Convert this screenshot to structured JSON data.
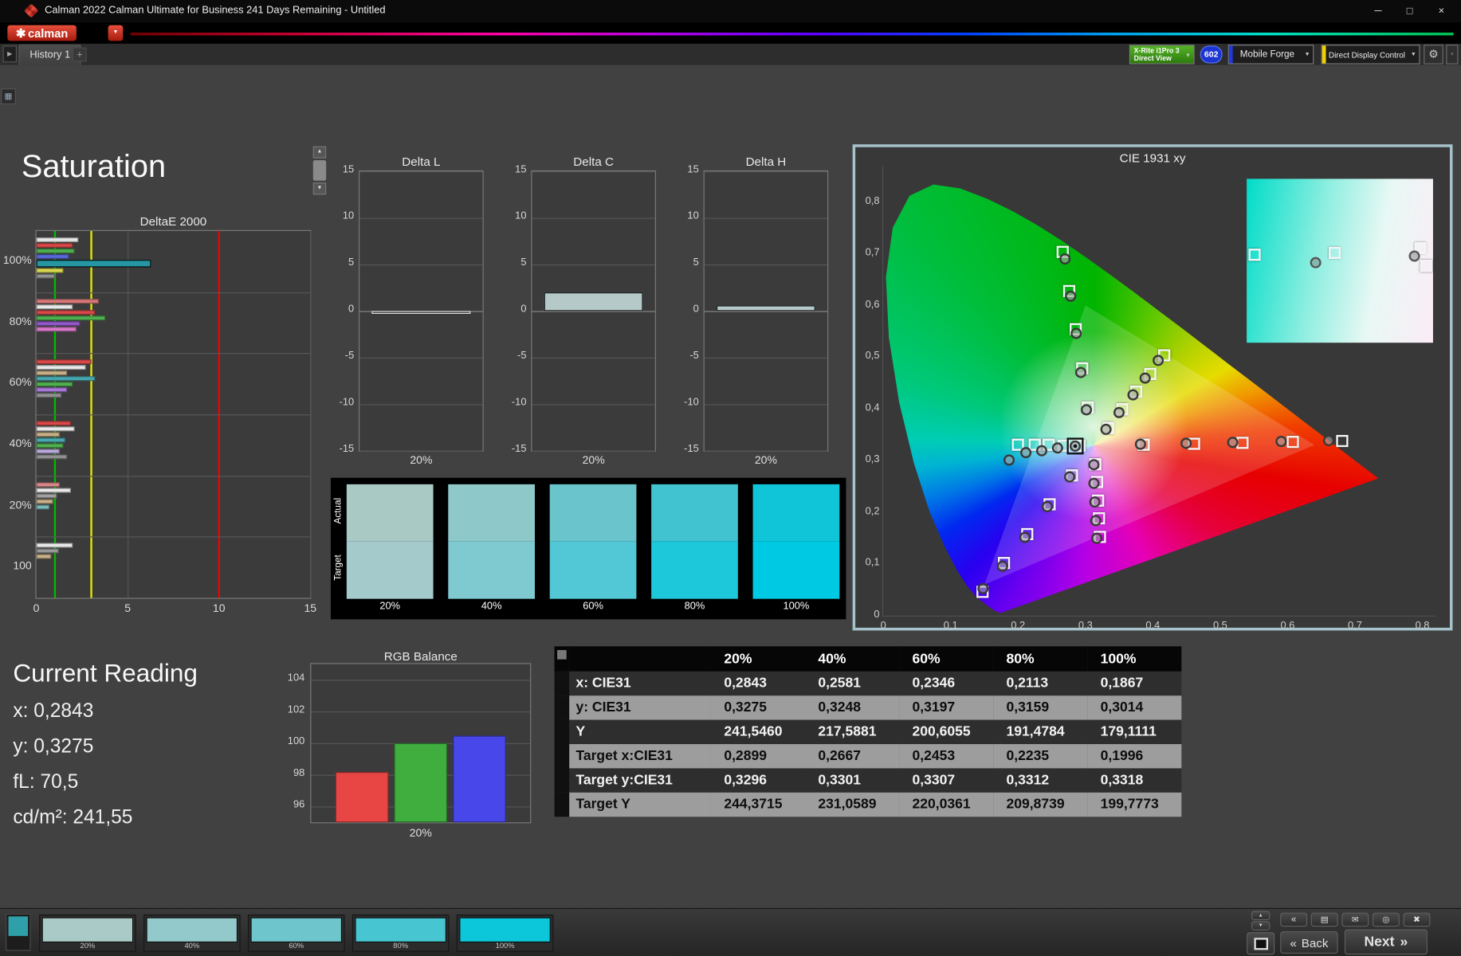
{
  "window": {
    "title": "Calman 2022 Calman Ultimate for Business 241 Days Remaining  - Untitled"
  },
  "brand": {
    "logo": "calman"
  },
  "tab_bar": {
    "tabs": [
      "History 1"
    ],
    "add": "+"
  },
  "toolbar": {
    "meter": {
      "line1": "X-Rite i1Pro 3",
      "line2": "Direct View"
    },
    "badge": "602",
    "source": "Mobile Forge",
    "source_accent": "#2038e0",
    "display_control": "Direct Display Control",
    "display_accent": "#f0d000"
  },
  "page": {
    "heading": "Saturation"
  },
  "current_reading": {
    "title": "Current Reading",
    "lines": [
      "x: 0,2843",
      "y: 0,3275",
      "fL: 70,5",
      "cd/m²: 241,55"
    ]
  },
  "footer": {
    "thumbnails": [
      {
        "label": "20%",
        "color": "#a9cac6"
      },
      {
        "label": "40%",
        "color": "#93c9ca"
      },
      {
        "label": "60%",
        "color": "#6ec6cc"
      },
      {
        "label": "80%",
        "color": "#47c5d0"
      },
      {
        "label": "100%",
        "color": "#0cc7da"
      }
    ],
    "back": "Back",
    "next": "Next"
  },
  "chart_data": [
    {
      "name": "deltaE2000",
      "type": "bar",
      "title": "DeltaE 2000",
      "orientation": "horizontal",
      "xlim": [
        0,
        15
      ],
      "xticks": [
        0,
        5,
        10,
        15
      ],
      "reference_lines": [
        {
          "value": 1,
          "color": "#00bb00"
        },
        {
          "value": 3,
          "color": "#e8e800"
        },
        {
          "value": 10,
          "color": "#ee0000"
        }
      ],
      "groups": [
        {
          "category": "100%",
          "bars": [
            {
              "color": "#e8e8e8",
              "value": 2.3
            },
            {
              "color": "#d84848",
              "value": 2.0
            },
            {
              "color": "#50b050",
              "value": 2.1
            },
            {
              "color": "#5868d8",
              "value": 1.8
            },
            {
              "color": "#2596a2",
              "value": 6.3,
              "emphasis": true
            },
            {
              "color": "#d8d850",
              "value": 1.5
            },
            {
              "color": "#909090",
              "value": 1.0
            }
          ]
        },
        {
          "category": "80%",
          "bars": [
            {
              "color": "#d87878",
              "value": 3.4
            },
            {
              "color": "#e8e8e8",
              "value": 2.0
            },
            {
              "color": "#d84848",
              "value": 3.2
            },
            {
              "color": "#50b050",
              "value": 3.8
            },
            {
              "color": "#9058c8",
              "value": 2.4
            },
            {
              "color": "#d878c8",
              "value": 2.2
            }
          ]
        },
        {
          "category": "60%",
          "bars": [
            {
              "color": "#d84848",
              "value": 3.0
            },
            {
              "color": "#e8e8e8",
              "value": 2.7
            },
            {
              "color": "#c8b088",
              "value": 1.7
            },
            {
              "color": "#48a8b0",
              "value": 3.2
            },
            {
              "color": "#50b050",
              "value": 2.0
            },
            {
              "color": "#a878d8",
              "value": 1.7
            },
            {
              "color": "#909090",
              "value": 1.4
            }
          ]
        },
        {
          "category": "40%",
          "bars": [
            {
              "color": "#d84848",
              "value": 1.9
            },
            {
              "color": "#e8e8e8",
              "value": 2.1
            },
            {
              "color": "#c8b088",
              "value": 1.3
            },
            {
              "color": "#48a8b0",
              "value": 1.6
            },
            {
              "color": "#50b050",
              "value": 1.5
            },
            {
              "color": "#b8a8d8",
              "value": 1.3
            },
            {
              "color": "#909090",
              "value": 1.7
            }
          ]
        },
        {
          "category": "20%",
          "bars": [
            {
              "color": "#d88888",
              "value": 1.3
            },
            {
              "color": "#e8e8e8",
              "value": 1.9
            },
            {
              "color": "#a0a0a0",
              "value": 1.1
            },
            {
              "color": "#c8b088",
              "value": 0.9
            },
            {
              "color": "#78b8b8",
              "value": 0.7
            }
          ]
        },
        {
          "category": "100",
          "bars": [
            {
              "color": "#e8e8e8",
              "value": 2.0
            },
            {
              "color": "#989898",
              "value": 1.2
            },
            {
              "color": "#c8b088",
              "value": 0.8
            }
          ]
        }
      ]
    },
    {
      "name": "deltaL",
      "type": "bar",
      "title": "Delta L",
      "xlabel": "20%",
      "ylim": [
        -15,
        15
      ],
      "yticks": [
        15,
        10,
        5,
        0,
        -5,
        -10,
        -15
      ],
      "value": -0.3,
      "bar_color": "#262626",
      "bar_border": "#e8e8e8"
    },
    {
      "name": "deltaC",
      "type": "bar",
      "title": "Delta C",
      "xlabel": "20%",
      "ylim": [
        -15,
        15
      ],
      "yticks": [
        15,
        10,
        5,
        0,
        -5,
        -10,
        -15
      ],
      "value": 2.0,
      "bar_color": "#b5c9c9",
      "bar_border": "#1a1a1a"
    },
    {
      "name": "deltaH",
      "type": "bar",
      "title": "Delta H",
      "xlabel": "20%",
      "ylim": [
        -15,
        15
      ],
      "yticks": [
        15,
        10,
        5,
        0,
        -5,
        -10,
        -15
      ],
      "value": 0.6,
      "bar_color": "#b5c9c9",
      "bar_border": "#1a1a1a"
    },
    {
      "name": "saturation_swatches",
      "type": "table",
      "row_labels": [
        "Actual",
        "Target"
      ],
      "levels": [
        "20%",
        "40%",
        "60%",
        "80%",
        "100%"
      ],
      "actual": [
        "#a9c9c5",
        "#8ec8c9",
        "#69c5cb",
        "#41c4cf",
        "#0fc5d7"
      ],
      "target": [
        "#a4cacc",
        "#7fc9d0",
        "#52c7d5",
        "#1ec8db",
        "#00cae3"
      ]
    },
    {
      "name": "cie1931",
      "type": "scatter",
      "title": "CIE 1931 xy",
      "xlim": [
        0,
        0.82
      ],
      "ylim": [
        0,
        0.87
      ],
      "ticks": [
        0,
        0.1,
        0.2,
        0.3,
        0.4,
        0.5,
        0.6,
        0.7,
        0.8
      ],
      "tick_labels": [
        "0",
        "0,1",
        "0,2",
        "0,3",
        "0,4",
        "0,5",
        "0,6",
        "0,7",
        "0,8"
      ],
      "gamut_triangle": [
        [
          0.64,
          0.33
        ],
        [
          0.3,
          0.6
        ],
        [
          0.15,
          0.06
        ]
      ],
      "targets": [
        [
          0.386,
          0.331
        ],
        [
          0.46,
          0.333
        ],
        [
          0.533,
          0.335
        ],
        [
          0.607,
          0.337
        ],
        [
          0.68,
          0.339
        ],
        [
          0.303,
          0.404
        ],
        [
          0.294,
          0.479
        ],
        [
          0.285,
          0.554
        ],
        [
          0.275,
          0.629
        ],
        [
          0.266,
          0.704
        ],
        [
          0.279,
          0.272
        ],
        [
          0.246,
          0.216
        ],
        [
          0.213,
          0.159
        ],
        [
          0.179,
          0.103
        ],
        [
          0.146,
          0.046
        ],
        [
          0.2899,
          0.3296
        ],
        [
          0.2667,
          0.3301
        ],
        [
          0.2453,
          0.3307
        ],
        [
          0.2235,
          0.3312
        ],
        [
          0.1996,
          0.3318
        ],
        [
          0.314,
          0.294
        ],
        [
          0.316,
          0.259
        ],
        [
          0.318,
          0.224
        ],
        [
          0.319,
          0.189
        ],
        [
          0.321,
          0.154
        ],
        [
          0.333,
          0.364
        ],
        [
          0.354,
          0.399
        ],
        [
          0.375,
          0.434
        ],
        [
          0.395,
          0.469
        ],
        [
          0.416,
          0.504
        ]
      ],
      "measurements": [
        [
          0.381,
          0.332
        ],
        [
          0.449,
          0.334
        ],
        [
          0.519,
          0.335
        ],
        [
          0.59,
          0.336
        ],
        [
          0.661,
          0.338
        ],
        [
          0.302,
          0.398
        ],
        [
          0.293,
          0.47
        ],
        [
          0.286,
          0.545
        ],
        [
          0.278,
          0.617
        ],
        [
          0.27,
          0.69
        ],
        [
          0.277,
          0.268
        ],
        [
          0.243,
          0.21
        ],
        [
          0.21,
          0.152
        ],
        [
          0.177,
          0.096
        ],
        [
          0.148,
          0.052
        ],
        [
          0.2843,
          0.3275
        ],
        [
          0.2581,
          0.3248
        ],
        [
          0.2346,
          0.3197
        ],
        [
          0.2113,
          0.3159
        ],
        [
          0.1867,
          0.3014
        ],
        [
          0.312,
          0.291
        ],
        [
          0.313,
          0.255
        ],
        [
          0.314,
          0.219
        ],
        [
          0.315,
          0.184
        ],
        [
          0.317,
          0.15
        ],
        [
          0.331,
          0.36
        ],
        [
          0.35,
          0.393
        ],
        [
          0.37,
          0.427
        ],
        [
          0.389,
          0.46
        ],
        [
          0.408,
          0.493
        ]
      ],
      "current": [
        0.2843,
        0.3275
      ],
      "inset": {
        "squares": [
          [
            4,
            46
          ],
          [
            47,
            45
          ],
          [
            93,
            42
          ],
          [
            96,
            53
          ]
        ],
        "circles": [
          [
            37,
            51
          ],
          [
            90,
            47
          ]
        ]
      }
    },
    {
      "name": "rgb_balance",
      "type": "bar",
      "title": "RGB Balance",
      "xlabel": "20%",
      "ylim": [
        95,
        105
      ],
      "yticks": [
        104,
        102,
        100,
        98,
        96
      ],
      "series": [
        {
          "name": "Red",
          "value": 98.2,
          "color": "#e84545"
        },
        {
          "name": "Green",
          "value": 100.0,
          "color": "#3fae3f"
        },
        {
          "name": "Blue",
          "value": 100.5,
          "color": "#4747ea"
        }
      ]
    },
    {
      "name": "saturation_table",
      "type": "table",
      "columns": [
        "20%",
        "40%",
        "60%",
        "80%",
        "100%"
      ],
      "rows": [
        {
          "label": "x: CIE31",
          "values": [
            "0,2843",
            "0,2581",
            "0,2346",
            "0,2113",
            "0,1867"
          ]
        },
        {
          "label": "y: CIE31",
          "values": [
            "0,3275",
            "0,3248",
            "0,3197",
            "0,3159",
            "0,3014"
          ]
        },
        {
          "label": "Y",
          "values": [
            "241,5460",
            "217,5881",
            "200,6055",
            "191,4784",
            "179,1111"
          ]
        },
        {
          "label": "Target x:CIE31",
          "values": [
            "0,2899",
            "0,2667",
            "0,2453",
            "0,2235",
            "0,1996"
          ]
        },
        {
          "label": "Target y:CIE31",
          "values": [
            "0,3296",
            "0,3301",
            "0,3307",
            "0,3312",
            "0,3318"
          ]
        },
        {
          "label": "Target Y",
          "values": [
            "244,3715",
            "231,0589",
            "220,0361",
            "209,8739",
            "199,7773"
          ]
        }
      ]
    }
  ]
}
